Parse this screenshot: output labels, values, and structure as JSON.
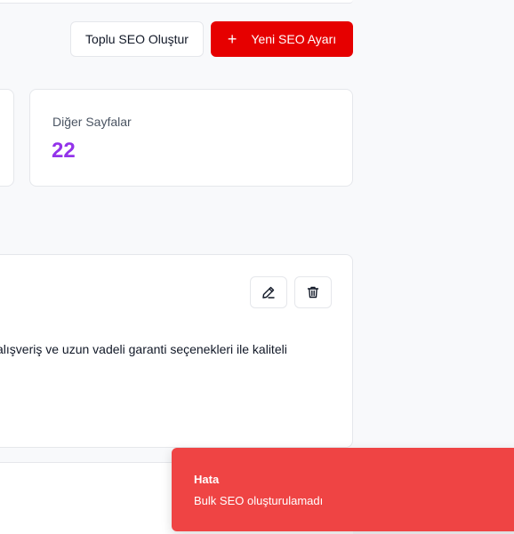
{
  "actions": {
    "bulk_create_label": "Toplu SEO Oluştur",
    "new_seo_label": "Yeni SEO Ayarı",
    "new_seo_icon": "plus-icon"
  },
  "stats": {
    "other_pages": {
      "label": "Diğer Sayfalar",
      "value": "22",
      "color": "#9333ea"
    }
  },
  "seo_item": {
    "description": "alışveriş ve uzun vadeli garanti seçenekleri ile kaliteli",
    "edit_icon": "pencil-icon",
    "delete_icon": "trash-icon"
  },
  "toast": {
    "title": "Hata",
    "message": "Bulk SEO oluşturulamadı",
    "color": "#ef4444"
  },
  "colors": {
    "primary": "#e60000",
    "background": "#f8f9fb"
  }
}
